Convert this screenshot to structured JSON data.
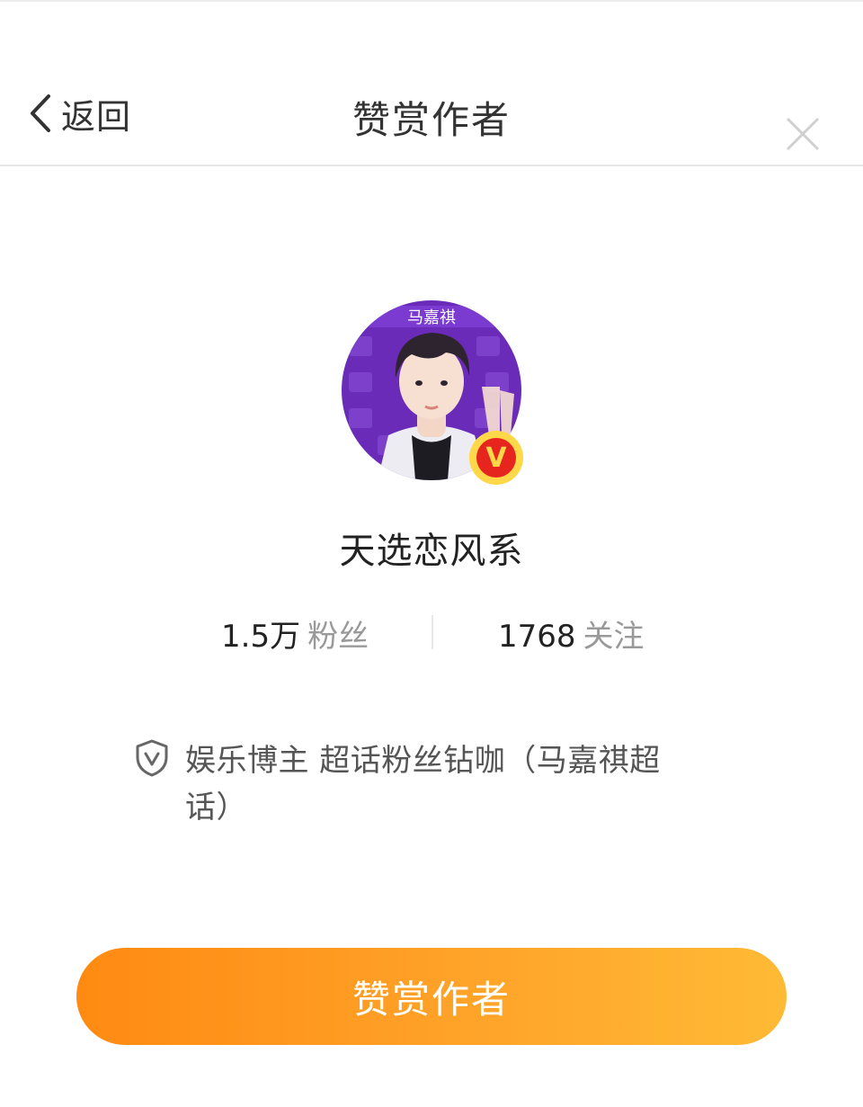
{
  "header": {
    "back_label": "返回",
    "title": "赞赏作者",
    "back_icon": "chevron-left-icon",
    "close_icon": "close-icon"
  },
  "profile": {
    "username": "天选恋风系",
    "avatar_caption": "马嘉祺",
    "verified_badge": "V",
    "fans_count": "1.5万",
    "fans_label": "粉丝",
    "following_count": "1768",
    "following_label": "关注",
    "verification": "娱乐博主 超话粉丝钻咖（马嘉祺超话）",
    "verification_icon": "shield-check-icon"
  },
  "action": {
    "reward_button_label": "赞赏作者"
  },
  "colors": {
    "button_gradient_start": "#ff8a12",
    "button_gradient_end": "#ffba35",
    "badge_red": "#e6251e",
    "badge_gold": "#ffd84a",
    "avatar_bg": "#6a2bb8"
  }
}
